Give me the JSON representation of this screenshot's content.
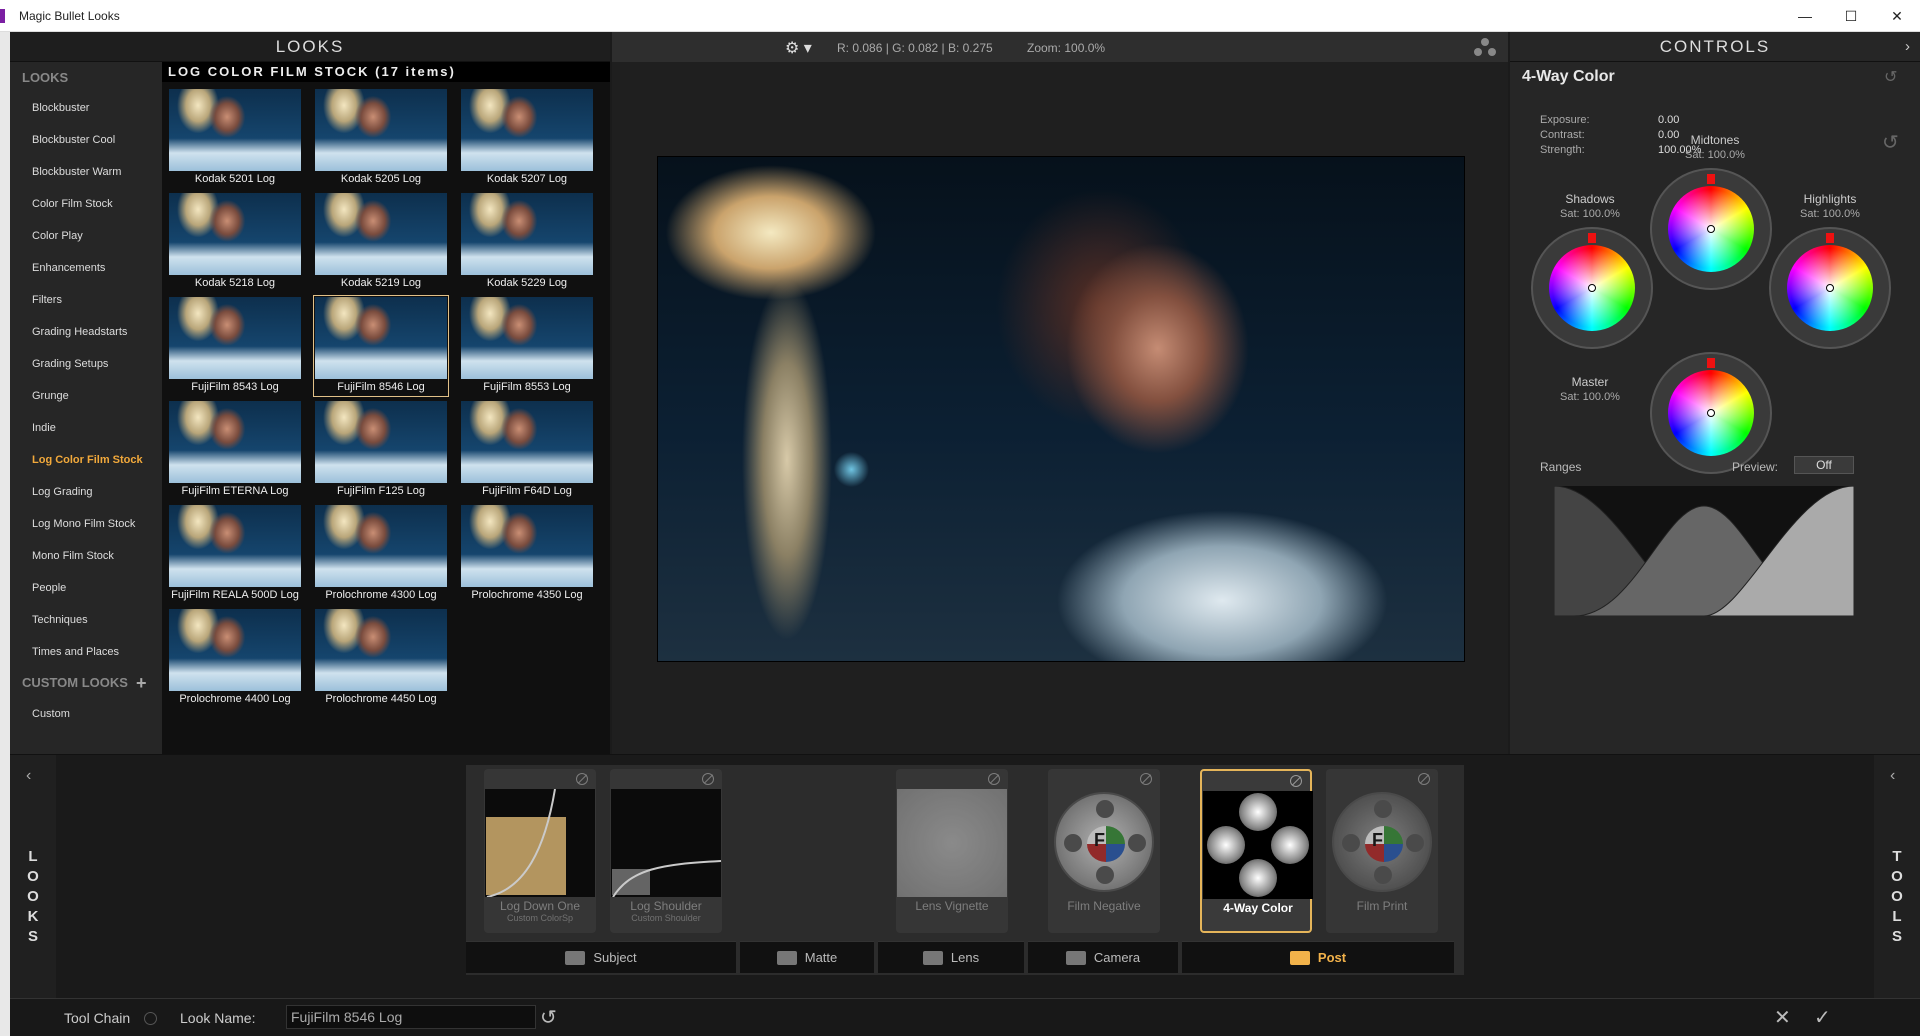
{
  "window": {
    "title": "Magic Bullet Looks",
    "minimize": "—",
    "maximize": "☐",
    "close": "✕"
  },
  "looks_panel": {
    "header": "LOOKS",
    "categories_title": "LOOKS",
    "categories": [
      "Blockbuster",
      "Blockbuster Cool",
      "Blockbuster Warm",
      "Color Film Stock",
      "Color Play",
      "Enhancements",
      "Filters",
      "Grading Headstarts",
      "Grading Setups",
      "Grunge",
      "Indie",
      "Log Color Film Stock",
      "Log Grading",
      "Log Mono Film Stock",
      "Mono Film Stock",
      "People",
      "Techniques",
      "Times and Places"
    ],
    "active_category": "Log Color Film Stock",
    "custom_title": "CUSTOM LOOKS",
    "custom_plus": "+",
    "custom_items": [
      "Custom"
    ]
  },
  "grid": {
    "title": "LOG COLOR FILM STOCK (17 items)",
    "items": [
      "Kodak 5201 Log",
      "Kodak 5205 Log",
      "Kodak 5207 Log",
      "Kodak 5218 Log",
      "Kodak 5219 Log",
      "Kodak 5229 Log",
      "FujiFilm 8543 Log",
      "FujiFilm 8546 Log",
      "FujiFilm 8553 Log",
      "FujiFilm ETERNA Log",
      "FujiFilm F125 Log",
      "FujiFilm F64D Log",
      "FujiFilm REALA 500D Log",
      "Prolochrome 4300 Log",
      "Prolochrome 4350 Log",
      "Prolochrome 4400 Log",
      "Prolochrome 4450 Log"
    ],
    "selected": "FujiFilm 8546 Log"
  },
  "viewer": {
    "gear_icon": "⚙ ▾",
    "readout": "R: 0.086 | G: 0.082 | B: 0.275",
    "zoom": "Zoom: 100.0%"
  },
  "controls": {
    "header": "CONTROLS",
    "chevron": "›",
    "tool_title": "4-Way Color",
    "reset_icon": "↺",
    "params": [
      {
        "label": "Exposure:",
        "value": "0.00"
      },
      {
        "label": "Contrast:",
        "value": "0.00"
      },
      {
        "label": "Strength:",
        "value": "100.00%"
      }
    ],
    "wheels": {
      "midtones": {
        "label": "Midtones",
        "sat": "Sat:  100.0%"
      },
      "shadows": {
        "label": "Shadows",
        "sat": "Sat:  100.0%"
      },
      "highlights": {
        "label": "Highlights",
        "sat": "Sat:  100.0%"
      },
      "master": {
        "label": "Master",
        "sat": "Sat:  100.0%"
      }
    },
    "ranges_label": "Ranges",
    "preview_label": "Preview:",
    "preview_value": "Off"
  },
  "bottom": {
    "left_tab": {
      "arrow": "‹",
      "letters": "L\nO\nO\nK\nS"
    },
    "right_tab": {
      "arrow": "‹",
      "letters": "T\nO\nO\nL\nS"
    },
    "tools": [
      {
        "name": "Log Down One",
        "sub": "Custom ColorSp"
      },
      {
        "name": "Log Shoulder",
        "sub": "Custom Shoulder"
      },
      {
        "name": "Lens Vignette",
        "sub": ""
      },
      {
        "name": "Film Negative",
        "sub": ""
      },
      {
        "name": "4-Way Color",
        "sub": ""
      },
      {
        "name": "Film Print",
        "sub": ""
      }
    ],
    "segments": [
      "Subject",
      "Matte",
      "Lens",
      "Camera",
      "Post"
    ],
    "active_segment": "Post"
  },
  "bottombar": {
    "tool_chain": "Tool Chain",
    "look_name_label": "Look Name:",
    "look_name_value": "FujiFilm 8546 Log",
    "undo_icon": "↺",
    "cancel_icon": "✕",
    "accept_icon": "✓"
  },
  "colors": {
    "accent": "#f2a93b",
    "selection": "#e2c188",
    "bg": "#1b1b1b"
  }
}
